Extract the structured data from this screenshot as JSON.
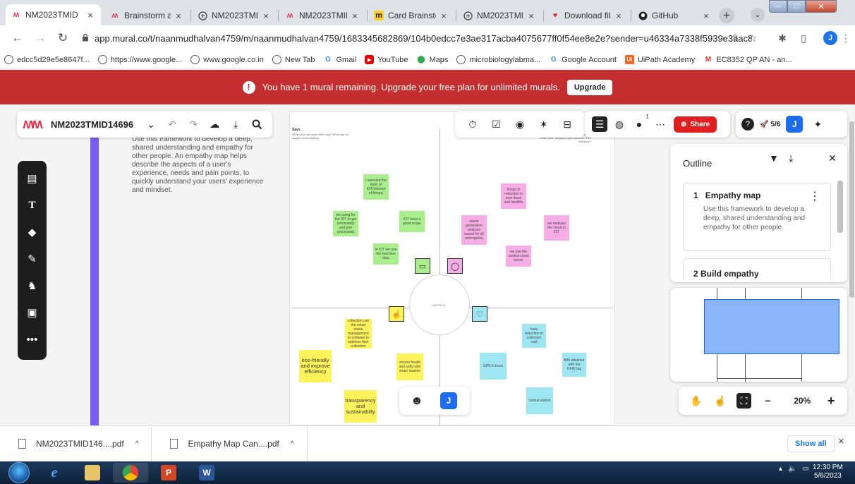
{
  "browser": {
    "tabs": [
      {
        "title": "NM2023TMID",
        "favicon": "mural-logo-icon",
        "active": true
      },
      {
        "title": "Brainstorm and",
        "favicon": "mural-logo-icon"
      },
      {
        "title": "NM2023TMID",
        "favicon": "globe-icon"
      },
      {
        "title": "NM2023TMID",
        "favicon": "mural-logo-icon"
      },
      {
        "title": "Card Brainstorm",
        "favicon": "miro-icon"
      },
      {
        "title": "NM2023TMID",
        "favicon": "globe-icon"
      },
      {
        "title": "Download file",
        "favicon": "heart-icon"
      },
      {
        "title": "GitHub",
        "favicon": "github-icon"
      }
    ],
    "tab_close": "×",
    "new_tab": "+",
    "url_host": "app.mural.co",
    "url_path": "/t/naanmudhalvan4759/m/naanmudhalvan4759/1683345682869/104b0edcc7e3ae317acba4075677ff0f54ee8e2e?sender=u46334a7338f5939e3aac8891",
    "profile_initial": "J",
    "bookmarks": [
      {
        "label": "edcc5d29e5e8647f...",
        "icon": "globe-icon"
      },
      {
        "label": "https://www.google...",
        "icon": "globe-icon"
      },
      {
        "label": "www.google.co.in",
        "icon": "globe-icon"
      },
      {
        "label": "New Tab",
        "icon": "globe-icon"
      },
      {
        "label": "Gmail",
        "icon": "google-icon"
      },
      {
        "label": "YouTube",
        "icon": "youtube-icon"
      },
      {
        "label": "Maps",
        "icon": "maps-icon"
      },
      {
        "label": "microbiologylabma...",
        "icon": "globe-icon"
      },
      {
        "label": "Google Account",
        "icon": "google-icon"
      },
      {
        "label": "UiPath Academy",
        "icon": "uipath-icon"
      },
      {
        "label": "EC8352 QP AN - an...",
        "icon": "gmail-icon"
      }
    ]
  },
  "banner": {
    "message": "You have 1 mural remaining. Upgrade your free plan for unlimited murals.",
    "upgrade_label": "Upgrade",
    "color": "#c42e2e"
  },
  "mural": {
    "name": "NM2023TMID14696",
    "share_label": "Share",
    "counter": "5/6",
    "user_initial": "J",
    "notification_count": "1",
    "intro_text": "Use this framework to develop a deep, shared understanding and empathy for other people. An empathy map helps describe the aspects of a user's experience, needs and pain points, to quickly understand your users' experience and mindset.",
    "quadrant_says": "Says",
    "quadrant_says_question": "What have we heard them say? What can we imagine them saying?",
    "quadrant_thinks_question": "What are their wants, needs, hopes, and dreams? What other thoughts might influence their behavior?",
    "center_label": "WASTE M...",
    "stickies": [
      {
        "text": "I selected the topic of IOT(internet of things)",
        "color": "green"
      },
      {
        "text": "we using for the IOT to get processing and port processing",
        "color": "green"
      },
      {
        "text": "IOT have a great scope",
        "color": "green"
      },
      {
        "text": "in IOT we use the real time data",
        "color": "green"
      },
      {
        "text": "things in reduction in over flows and landfills",
        "color": "pink"
      },
      {
        "text": "waste generation analysis based for all metropolies",
        "color": "pink"
      },
      {
        "text": "we analysis the cloud in IOT",
        "color": "pink"
      },
      {
        "text": "we use the central cloud server",
        "color": "pink"
      },
      {
        "text": "waste collection use the smart waste management to software to optimize their collection routes",
        "color": "yellow"
      },
      {
        "text": "eco-friendly and improve efficiency",
        "color": "yellow"
      },
      {
        "text": "ensure health and safty with smart duation",
        "color": "yellow"
      },
      {
        "text": "transparency and sustainabilty",
        "color": "yellow"
      },
      {
        "text": "fuels reduction in collection cost",
        "color": "cyan"
      },
      {
        "text": "GPS in truck",
        "color": "cyan"
      },
      {
        "text": "BIN attached with the RFID tag",
        "color": "cyan"
      },
      {
        "text": "central station",
        "color": "cyan"
      }
    ]
  },
  "outline": {
    "title": "Outline",
    "item1_number": "1",
    "item1_title": "Empathy map",
    "item1_desc": "Use this framework to develop a deep, shared understanding and empathy for other people.",
    "item2_partial": "2 Build empathy"
  },
  "zoom": {
    "value": "20%",
    "minus": "−",
    "plus": "+"
  },
  "downloads": {
    "items": [
      "NM2023TMID146....pdf",
      "Empathy Map Can....pdf"
    ],
    "show_all": "Show all",
    "close": "×"
  },
  "taskbar": {
    "time": "12:30 PM",
    "date": "5/6/2023"
  }
}
